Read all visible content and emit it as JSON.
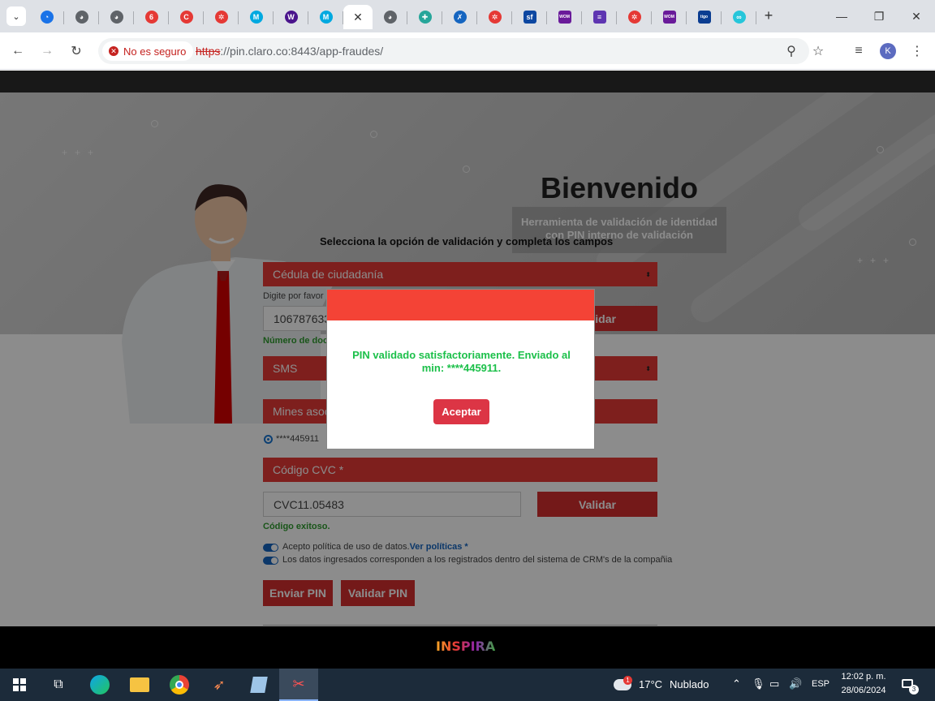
{
  "browser": {
    "tabs": [
      {
        "icon": "chrome-icon",
        "color": "#1a73e8",
        "glyph": "◔"
      },
      {
        "icon": "globe-icon",
        "color": "#5f6368",
        "glyph": "◕"
      },
      {
        "icon": "globe-icon",
        "color": "#5f6368",
        "glyph": "◕"
      },
      {
        "icon": "claro-icon",
        "color": "#e53935",
        "glyph": "6"
      },
      {
        "icon": "claro-c-icon",
        "color": "#e53935",
        "glyph": "C"
      },
      {
        "icon": "claro-burst-icon",
        "color": "#e53935",
        "glyph": "✲"
      },
      {
        "icon": "movistar-icon",
        "color": "#00a9e0",
        "glyph": "M"
      },
      {
        "icon": "w-icon",
        "color": "#4a148c",
        "glyph": "W"
      },
      {
        "icon": "movistar-icon",
        "color": "#00a9e0",
        "glyph": "M"
      },
      {
        "icon": "close-icon",
        "active": true
      },
      {
        "icon": "globe-icon",
        "color": "#5f6368",
        "glyph": "◕"
      },
      {
        "icon": "plus-cross-icon",
        "color": "#26a69a",
        "glyph": "✚"
      },
      {
        "icon": "runner-icon",
        "color": "#1565c0",
        "glyph": "✗"
      },
      {
        "icon": "claro-burst-icon",
        "color": "#e53935",
        "glyph": "✲"
      },
      {
        "icon": "sf-icon",
        "color": "#0d47a1",
        "glyph": "sf"
      },
      {
        "icon": "wom-icon",
        "color": "#6a1b9a",
        "glyph": "WOM"
      },
      {
        "icon": "forms-icon",
        "color": "#5e35b1",
        "glyph": "≡"
      },
      {
        "icon": "claro-burst-icon",
        "color": "#e53935",
        "glyph": "✲"
      },
      {
        "icon": "wom-icon",
        "color": "#6a1b9a",
        "glyph": "WOM"
      },
      {
        "icon": "tigo-icon",
        "color": "#0b3d91",
        "glyph": "tigo"
      },
      {
        "icon": "sync-icon",
        "color": "#26c6da",
        "glyph": "∞"
      }
    ],
    "address": {
      "security_label": "No es seguro",
      "url_scheme": "https",
      "url_rest": "://pin.claro.co:8443/app-fraudes/"
    },
    "profile_initial": "K"
  },
  "page": {
    "welcome_title": "Bienvenido",
    "welcome_subtitle": "Herramienta de validación de identidad con PIN interno de validación",
    "instruction": "Selecciona la opción de validación y completa los campos",
    "id_type_select": "Cédula de ciudadanía",
    "digite_label": "Digite por favor",
    "document_value": "106787633",
    "validar_label_1": "Validar",
    "document_status": "Número de documento",
    "channel_select": "SMS",
    "mines_field": "Mines asociados",
    "phone_option": "****445911",
    "cvc_label": "Código CVC *",
    "cvc_value": "CVC11.05483",
    "validar_label_2": "Validar",
    "cvc_status": "Código exitoso.",
    "policy_1_text": "Acepto política de uso de datos.",
    "policy_1_link": "Ver políticas *",
    "policy_2_text": "Los datos ingresados corresponden a los registrados dentro del sistema de CRM's de la compañia",
    "send_pin": "Enviar PIN",
    "validate_pin": "Validar PIN",
    "footer_brand": "INSPIRA"
  },
  "modal": {
    "message": "PIN validado satisfactoriamente. Enviado al min: ****445911.",
    "accept": "Aceptar",
    "header_color": "#f44336"
  },
  "taskbar": {
    "weather_temp": "17°C",
    "weather_desc": "Nublado",
    "weather_badge": "1",
    "language": "ESP",
    "time": "12:02 p. m.",
    "date": "28/06/2024",
    "notification_count": "3"
  }
}
